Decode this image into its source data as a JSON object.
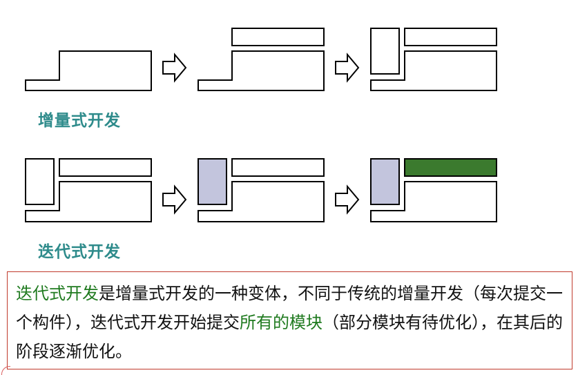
{
  "labels": {
    "incremental": "增量式开发",
    "iterative": "迭代式开发"
  },
  "note": {
    "part1_highlight": "迭代式开发",
    "part2": "是增量式开发的一种变体，不同于传统的增量开发（每次提交一个构件），迭代式开发开始提交",
    "part3_highlight": "所有的模块",
    "part4": "（部分模块有待优化），在其后的阶段逐渐优化。"
  },
  "colors": {
    "outline": "#000000",
    "module_gray": "#c3c5dd",
    "module_green": "#3b7a2e",
    "label_teal": "#2e8b8b",
    "highlight_green": "#1f7a1f",
    "note_border": "#c0392b"
  }
}
